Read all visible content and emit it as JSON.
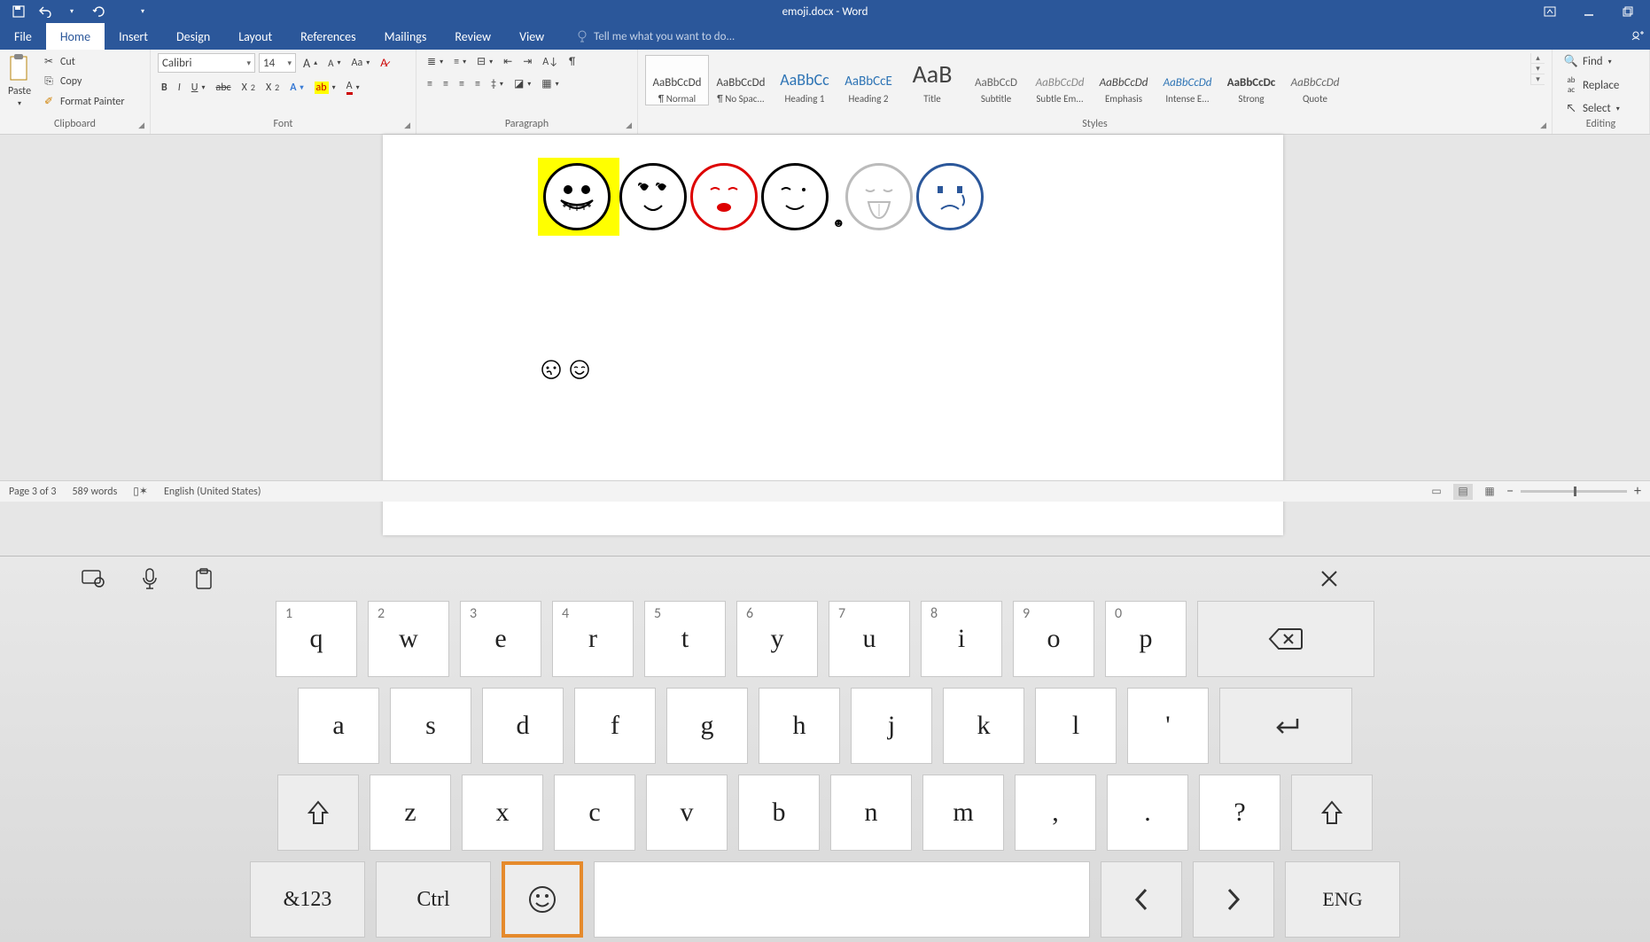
{
  "titlebar": {
    "doc_title": "emoji.docx - Word"
  },
  "tabs": {
    "file": "File",
    "home": "Home",
    "insert": "Insert",
    "design": "Design",
    "layout": "Layout",
    "references": "References",
    "mailings": "Mailings",
    "review": "Review",
    "view": "View",
    "tellme_placeholder": "Tell me what you want to do..."
  },
  "ribbon": {
    "clipboard": {
      "paste": "Paste",
      "cut": "Cut",
      "copy": "Copy",
      "format_painter": "Format Painter",
      "label": "Clipboard"
    },
    "font": {
      "name": "Calibri",
      "size": "14",
      "label": "Font"
    },
    "paragraph": {
      "label": "Paragraph"
    },
    "styles": {
      "label": "Styles",
      "items": [
        {
          "name": "¶ Normal",
          "preview": "AaBbCcDd",
          "cls": ""
        },
        {
          "name": "¶ No Spac...",
          "preview": "AaBbCcDd",
          "cls": ""
        },
        {
          "name": "Heading 1",
          "preview": "AaBbCc",
          "cls": "h1"
        },
        {
          "name": "Heading 2",
          "preview": "AaBbCcE",
          "cls": "h2"
        },
        {
          "name": "Title",
          "preview": "AaB",
          "cls": "ti"
        },
        {
          "name": "Subtitle",
          "preview": "AaBbCcD",
          "cls": "sub"
        },
        {
          "name": "Subtle Em...",
          "preview": "AaBbCcDd",
          "cls": "se"
        },
        {
          "name": "Emphasis",
          "preview": "AaBbCcDd",
          "cls": "em"
        },
        {
          "name": "Intense E...",
          "preview": "AaBbCcDd",
          "cls": "ie"
        },
        {
          "name": "Strong",
          "preview": "AaBbCcDc",
          "cls": "st"
        },
        {
          "name": "Quote",
          "preview": "AaBbCcDd",
          "cls": "qu"
        }
      ]
    },
    "editing": {
      "find": "Find",
      "replace": "Replace",
      "select": "Select",
      "label": "Editing"
    }
  },
  "statusbar": {
    "page": "Page 3 of 3",
    "words": "589 words",
    "lang": "English (United States)"
  },
  "osk": {
    "row1": [
      {
        "n": "1",
        "l": "q"
      },
      {
        "n": "2",
        "l": "w"
      },
      {
        "n": "3",
        "l": "e"
      },
      {
        "n": "4",
        "l": "r"
      },
      {
        "n": "5",
        "l": "t"
      },
      {
        "n": "6",
        "l": "y"
      },
      {
        "n": "7",
        "l": "u"
      },
      {
        "n": "8",
        "l": "i"
      },
      {
        "n": "9",
        "l": "o"
      },
      {
        "n": "0",
        "l": "p"
      }
    ],
    "row2": [
      "a",
      "s",
      "d",
      "f",
      "g",
      "h",
      "j",
      "k",
      "l",
      "'"
    ],
    "row3": [
      "z",
      "x",
      "c",
      "v",
      "b",
      "n",
      "m",
      ",",
      ".",
      "?"
    ],
    "sym": "&123",
    "ctrl": "Ctrl",
    "lang": "ENG"
  }
}
